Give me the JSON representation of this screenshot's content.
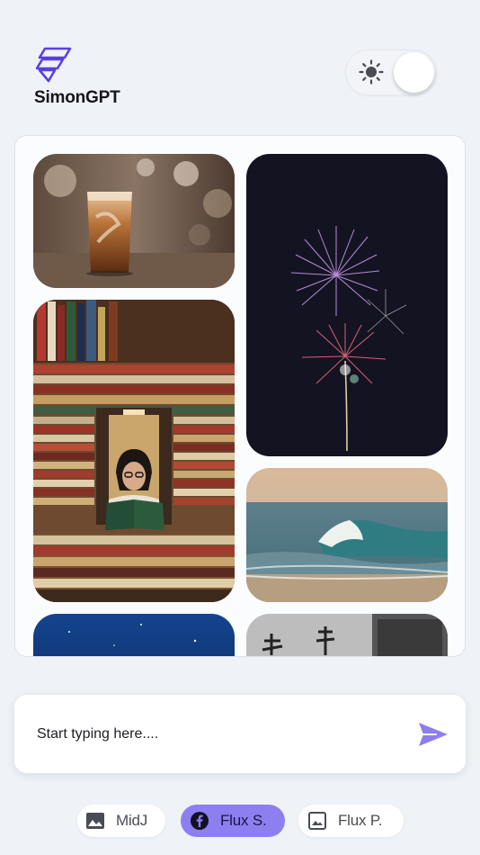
{
  "app": {
    "name": "SimonGPT",
    "logo_icon": "simongpt-logo-icon"
  },
  "theme_toggle": {
    "icon": "sun-icon",
    "state": "light"
  },
  "gallery": {
    "images": [
      {
        "subject": "iced coffee glass",
        "column": 1
      },
      {
        "subject": "fireworks at night",
        "column": 2
      },
      {
        "subject": "woman reading among stacks of books",
        "column": 1
      },
      {
        "subject": "ocean wave at beach",
        "column": 2
      },
      {
        "subject": "starry blue sky",
        "column": 1
      },
      {
        "subject": "grey building wall",
        "column": 2
      }
    ]
  },
  "composer": {
    "placeholder": "Start typing here....",
    "value": "",
    "send_icon": "send-icon"
  },
  "models": [
    {
      "label": "MidJ",
      "icon": "image-icon",
      "active": false
    },
    {
      "label": "Flux S.",
      "icon": "facebook-icon",
      "active": true
    },
    {
      "label": "Flux P.",
      "icon": "image-outline-icon",
      "active": false
    }
  ],
  "colors": {
    "accent": "#8d7ff0",
    "logo": "#5b3fe0",
    "background": "#eff2f7"
  }
}
